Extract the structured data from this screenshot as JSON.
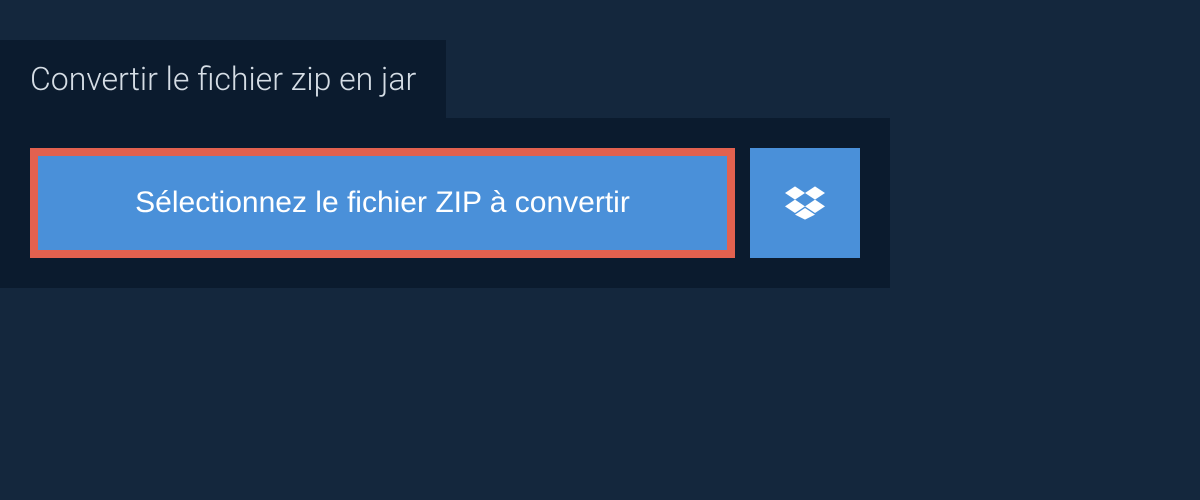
{
  "header": {
    "title": "Convertir le fichier zip en jar"
  },
  "actions": {
    "select_file_label": "Sélectionnez le fichier ZIP à convertir"
  },
  "colors": {
    "background": "#14273d",
    "panel": "#0b1b2e",
    "button": "#4a90d9",
    "highlight_border": "#e2614f"
  }
}
